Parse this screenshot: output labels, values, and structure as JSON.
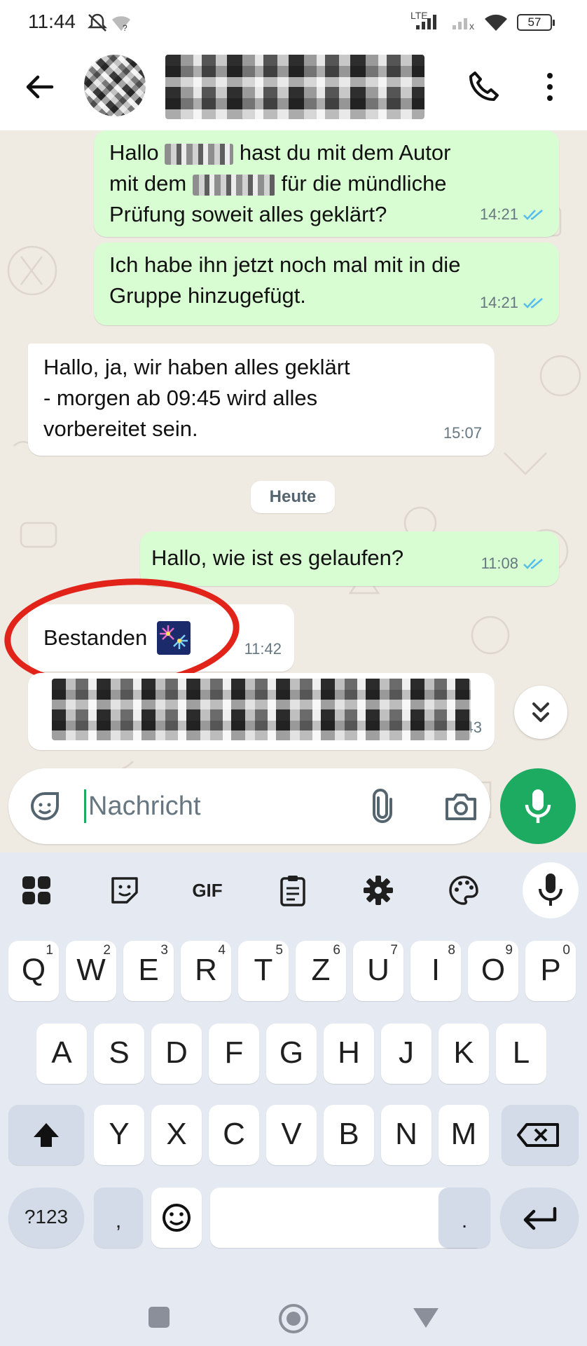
{
  "status_bar": {
    "time": "11:44",
    "network": "LTE",
    "battery": "57"
  },
  "header": {
    "contact_name": "",
    "back_icon": "arrow-left-icon",
    "call_icon": "phone-icon",
    "menu_icon": "more-vert-icon"
  },
  "messages": [
    {
      "dir": "out",
      "parts": [
        "Hallo ",
        " hast du mit dem Autor",
        "mit dem ",
        " für die mündliche",
        "Prüfung soweit alles geklärt?"
      ],
      "time": "14:21",
      "status": "read"
    },
    {
      "dir": "out",
      "lines": [
        "Ich habe ihn jetzt noch mal mit in die",
        "Gruppe hinzugefügt."
      ],
      "time": "14:21",
      "status": "read"
    },
    {
      "dir": "in",
      "lines": [
        "Hallo, ja, wir haben alles geklärt",
        "- morgen ab 09:45 wird alles",
        "vorbereitet sein."
      ],
      "time": "15:07"
    },
    {
      "dir": "out",
      "lines": [
        "Hallo, wie ist es gelaufen?"
      ],
      "time": "11:08",
      "status": "read"
    },
    {
      "dir": "in",
      "lines": [
        "Bestanden"
      ],
      "emoji": "fireworks",
      "time": "11:42",
      "highlighted": true
    },
    {
      "dir": "in",
      "lines": [],
      "time": "11:43",
      "redacted": true
    }
  ],
  "day_separator": "Heute",
  "composer": {
    "placeholder": "Nachricht",
    "emoji_icon": "sticker-smile-icon",
    "attach_icon": "paperclip-icon",
    "camera_icon": "camera-icon",
    "send_icon": "mic-icon"
  },
  "keyboard": {
    "toolbar": [
      "apps-grid-icon",
      "sticker-icon",
      "GIF",
      "clipboard-icon",
      "gear-icon",
      "palette-icon",
      "mic-icon"
    ],
    "row1": [
      [
        "Q",
        "1"
      ],
      [
        "W",
        "2"
      ],
      [
        "E",
        "3"
      ],
      [
        "R",
        "4"
      ],
      [
        "T",
        "5"
      ],
      [
        "Z",
        "6"
      ],
      [
        "U",
        "7"
      ],
      [
        "I",
        "8"
      ],
      [
        "O",
        "9"
      ],
      [
        "P",
        "0"
      ]
    ],
    "row2": [
      "A",
      "S",
      "D",
      "F",
      "G",
      "H",
      "J",
      "K",
      "L"
    ],
    "row3": [
      "Y",
      "X",
      "C",
      "V",
      "B",
      "N",
      "M"
    ],
    "symbols_key": "?123",
    "comma_key": ",",
    "period_key": "."
  },
  "colors": {
    "outgoing": "#d9fdd3",
    "incoming": "#ffffff",
    "accent": "#1daa61",
    "ticks": "#53bdeb",
    "annotation": "#e2231a"
  }
}
